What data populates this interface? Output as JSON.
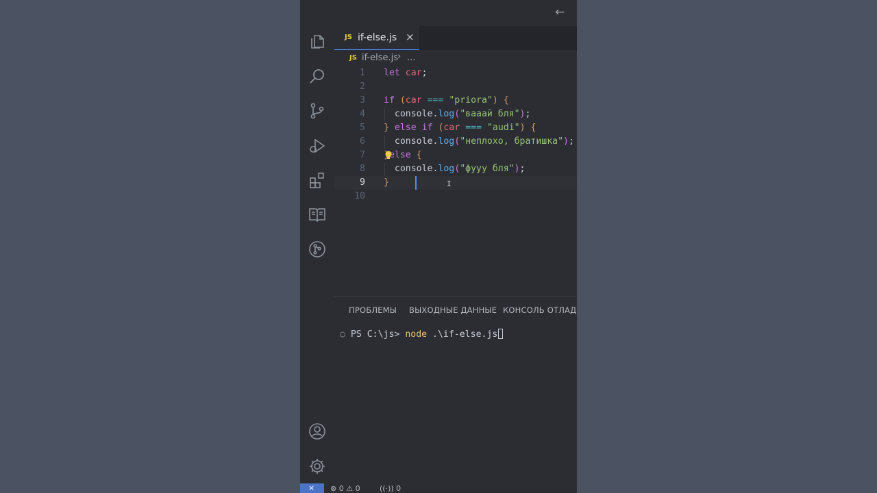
{
  "titlebar": {
    "back_icon": "arrow-left-icon",
    "back_glyph": "←"
  },
  "activity_bar": {
    "top": [
      "files-icon",
      "search-icon",
      "source-control-icon",
      "run-debug-icon",
      "extensions-icon",
      "book-icon",
      "git-graph-icon"
    ],
    "bottom": [
      "account-icon",
      "gear-icon"
    ]
  },
  "tab": {
    "badge": "JS",
    "title": "if-else.js",
    "close": "×"
  },
  "breadcrumb": {
    "badge": "JS",
    "file": "if-else.js",
    "sep": "›",
    "more": "..."
  },
  "editor": {
    "line_numbers": [
      "1",
      "2",
      "3",
      "4",
      "5",
      "6",
      "7",
      "8",
      "9",
      "10"
    ],
    "current_line": 9,
    "lines": [
      {
        "t": [
          [
            "kw",
            "let"
          ],
          [
            "pun",
            " "
          ],
          [
            "var",
            "car"
          ],
          [
            "pun",
            ";"
          ]
        ]
      },
      {
        "t": []
      },
      {
        "t": [
          [
            "kw",
            "if"
          ],
          [
            "pun",
            " "
          ],
          [
            "b1",
            "("
          ],
          [
            "var",
            "car"
          ],
          [
            "pun",
            " "
          ],
          [
            "op",
            "==="
          ],
          [
            "pun",
            " "
          ],
          [
            "str",
            "\"priora\""
          ],
          [
            "b1",
            ")"
          ],
          [
            "pun",
            " "
          ],
          [
            "b1",
            "{"
          ]
        ]
      },
      {
        "t": [
          [
            "pun",
            "  console."
          ],
          [
            "fn",
            "log"
          ],
          [
            "b2",
            "("
          ],
          [
            "str",
            "\"вааай бля\""
          ],
          [
            "b2",
            ")"
          ],
          [
            "pun",
            ";"
          ]
        ]
      },
      {
        "t": [
          [
            "b1",
            "}"
          ],
          [
            "pun",
            " "
          ],
          [
            "kw",
            "else"
          ],
          [
            "pun",
            " "
          ],
          [
            "kw",
            "if"
          ],
          [
            "pun",
            " "
          ],
          [
            "b1",
            "("
          ],
          [
            "var",
            "car"
          ],
          [
            "pun",
            " "
          ],
          [
            "op",
            "==="
          ],
          [
            "pun",
            " "
          ],
          [
            "str",
            "\"audi\""
          ],
          [
            "b1",
            ")"
          ],
          [
            "pun",
            " "
          ],
          [
            "b1",
            "{"
          ]
        ]
      },
      {
        "t": [
          [
            "pun",
            "  console."
          ],
          [
            "fn",
            "log"
          ],
          [
            "b2",
            "("
          ],
          [
            "str",
            "\"неплохо, братишка\""
          ],
          [
            "b2",
            ")"
          ],
          [
            "pun",
            ";"
          ]
        ]
      },
      {
        "t": [
          [
            "b1",
            "}"
          ],
          [
            "kw",
            "else"
          ],
          [
            "pun",
            " "
          ],
          [
            "b1",
            "{"
          ]
        ]
      },
      {
        "t": [
          [
            "pun",
            "  console."
          ],
          [
            "fn",
            "log"
          ],
          [
            "b2",
            "("
          ],
          [
            "str",
            "\"фууу бля\""
          ],
          [
            "b2",
            ")"
          ],
          [
            "pun",
            ";"
          ]
        ]
      },
      {
        "t": [
          [
            "b1",
            "}"
          ]
        ]
      },
      {
        "t": []
      }
    ]
  },
  "panel": {
    "tabs": [
      "ПРОБЛЕМЫ",
      "ВЫХОДНЫЕ ДАННЫЕ",
      "КОНСОЛЬ ОТЛАДКИ"
    ],
    "terminal": {
      "dot": "○",
      "prompt": "PS C:\\js>",
      "command": "node",
      "args": ".\\if-else.js"
    }
  },
  "statusbar": {
    "remote_glyph": "⨯",
    "errors": "⊗ 0 ⚠ 0",
    "ports": "((·)) 0"
  },
  "colors": {
    "accent": "#4b8df8",
    "js_badge": "#e8c54b",
    "keyword": "#c678dd",
    "string": "#98c379",
    "variable": "#e06c75"
  }
}
